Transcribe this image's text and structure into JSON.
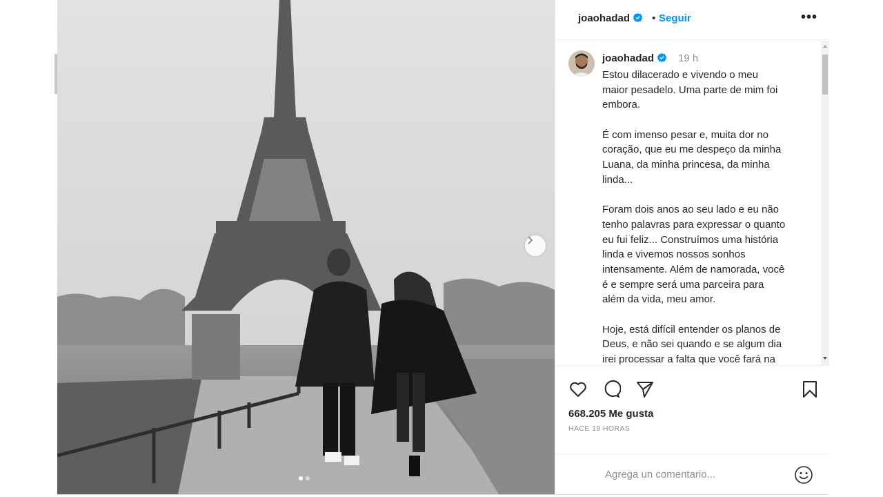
{
  "post": {
    "username": "joaohadad",
    "separator": "•",
    "follow_label": "Seguir",
    "more_label": "•••",
    "time_ago": "19 h",
    "caption": [
      "Estou dilacerado e vivendo o meu",
      "maior pesadelo. Uma parte de mim foi",
      "embora.",
      "",
      "É com imenso pesar e, muita dor no",
      "coração, que eu me despeço da minha",
      "Luana, da minha princesa, da minha",
      "linda...",
      "",
      "Foram dois anos ao seu lado e eu não",
      "tenho palavras para expressar o quanto",
      "eu fui feliz... Construímos uma história",
      "linda e vivemos nossos sonhos",
      "intensamente. Além de namorada, você",
      "é e sempre será uma parceira para",
      "além da vida, meu amor.",
      "",
      "Hoje, está difícil entender os planos de",
      "Deus, e não sei quando e se algum dia",
      "irei processar a falta que você fará na"
    ],
    "likes": "668.205 Me gusta",
    "posted_label": "HACE 19 HORAS",
    "comment_placeholder": "Agrega un comentario..."
  },
  "carousel": {
    "slide_count": 2,
    "active_index": 0
  },
  "icons": {
    "verified": "verified-badge-icon",
    "like": "heart-icon",
    "comment": "comment-bubble-icon",
    "share": "paper-plane-icon",
    "save": "bookmark-icon",
    "emoji": "smiley-icon",
    "next": "chevron-right-icon"
  },
  "colors": {
    "accent": "#0095f6",
    "text": "#262626",
    "muted": "#8e8e8e",
    "border": "#efefef"
  }
}
